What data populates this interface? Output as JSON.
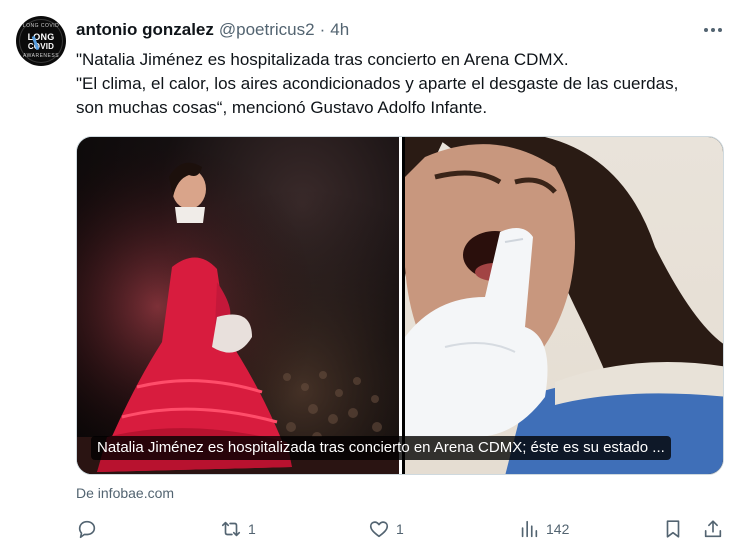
{
  "author": {
    "name": "antonio gonzalez",
    "handle": "@poetricus2",
    "separator": "·",
    "time": "4h",
    "avatar": {
      "top": "LONG COVID",
      "line1": "LONG",
      "line2": "COVID",
      "bottom": "AWARENESS"
    }
  },
  "post": {
    "lines": [
      "\"Natalia Jiménez es hospitalizada tras concierto en Arena CDMX.",
      "\"El clima, el calor, los aires acondicionados y aparte el desgaste de las cuerdas,",
      "son muchas cosas“, mencionó Gustavo Adolfo Infante."
    ]
  },
  "card": {
    "caption": "Natalia Jiménez es hospitalizada tras concierto en Arena CDMX; éste es su estado ...",
    "source": "De infobae.com"
  },
  "actions": {
    "replies": "",
    "reposts": "1",
    "likes": "1",
    "views": "142"
  },
  "icons": {
    "more": "more-dots-icon",
    "reply": "reply-icon",
    "repost": "repost-icon",
    "like": "heart-icon",
    "views": "views-chart-icon",
    "bookmark": "bookmark-icon",
    "share": "share-icon"
  },
  "colors": {
    "text": "#0f1419",
    "muted": "#536471",
    "border": "#cfd9de",
    "dress": "#d81c3e"
  }
}
